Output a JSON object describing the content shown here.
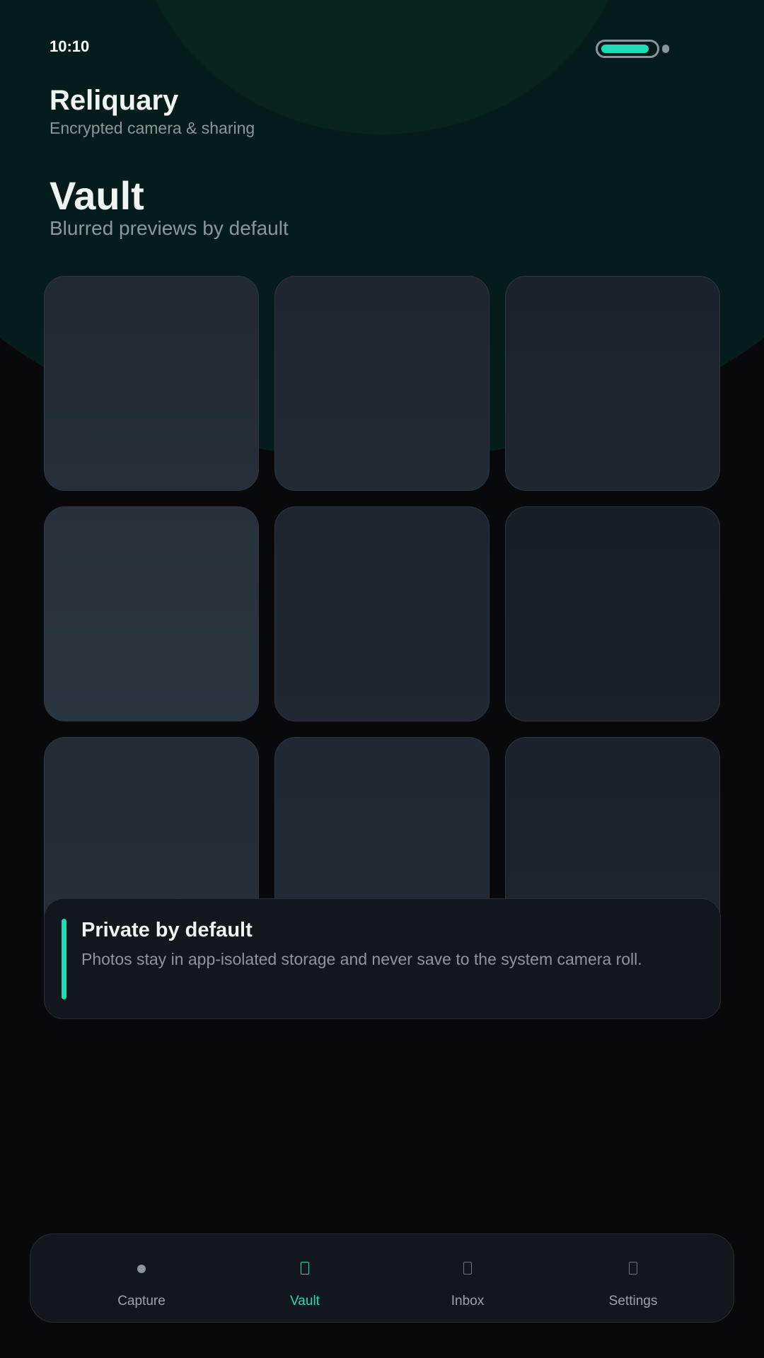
{
  "status_bar": {
    "time": "10:10",
    "battery_level_percent": 90
  },
  "app": {
    "title": "Reliquary",
    "subtitle": "Encrypted camera & sharing"
  },
  "page": {
    "title": "Vault",
    "subtitle": "Blurred previews by default"
  },
  "vault_grid": {
    "tiles": [
      {
        "name": "vault-tile-1",
        "top_color": "#212a33",
        "bottom_color": "#262f39"
      },
      {
        "name": "vault-tile-2",
        "top_color": "#1f2630",
        "bottom_color": "#222a34"
      },
      {
        "name": "vault-tile-3",
        "top_color": "#1b222b",
        "bottom_color": "#1f262f"
      },
      {
        "name": "vault-tile-4",
        "top_color": "#28313b",
        "bottom_color": "#2b3540"
      },
      {
        "name": "vault-tile-5",
        "top_color": "#1d242d",
        "bottom_color": "#202731"
      },
      {
        "name": "vault-tile-6",
        "top_color": "#181e26",
        "bottom_color": "#1b2129"
      },
      {
        "name": "vault-tile-7",
        "top_color": "#232b35",
        "bottom_color": "#262e38"
      },
      {
        "name": "vault-tile-8",
        "top_color": "#202833",
        "bottom_color": "#222a35"
      },
      {
        "name": "vault-tile-9",
        "top_color": "#1b222b",
        "bottom_color": "#1d242d"
      }
    ]
  },
  "notice": {
    "title": "Private by default",
    "text": "Photos stay in app-isolated storage and never save to the system camera roll.",
    "accent_color": "#1fdcb6"
  },
  "bottom_nav": {
    "active": "vault",
    "items": [
      {
        "id": "capture",
        "label": "Capture",
        "icon": "capture-dot-icon"
      },
      {
        "id": "vault",
        "label": "Vault",
        "icon": "vault-icon"
      },
      {
        "id": "inbox",
        "label": "Inbox",
        "icon": "inbox-icon"
      },
      {
        "id": "settings",
        "label": "Settings",
        "icon": "settings-icon"
      }
    ]
  },
  "colors": {
    "accent": "#1fdcb6",
    "background": "#07090c",
    "surface": "#12171e"
  }
}
